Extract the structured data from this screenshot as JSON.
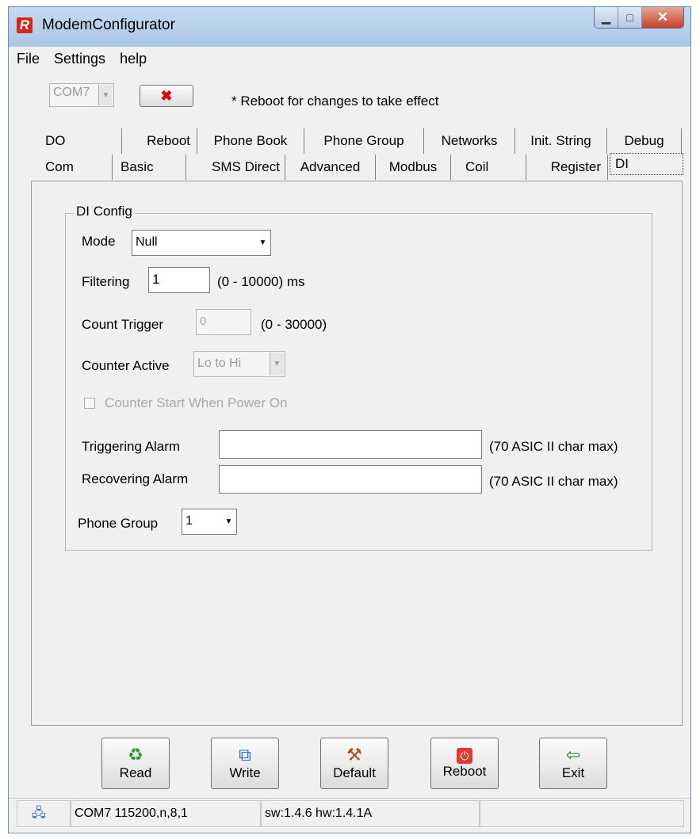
{
  "window": {
    "title": "ModemConfigurator",
    "icon": "R"
  },
  "menu": [
    "File",
    "Settings",
    "help"
  ],
  "toolbar": {
    "com_port": "COM7",
    "disconnect_icon": "red-x-icon",
    "notice": "* Reboot for changes to take effect"
  },
  "tabs": {
    "row1": [
      "DO",
      "Reboot",
      "Phone Book",
      "Phone Group",
      "Networks",
      "Init. String",
      "Debug"
    ],
    "row2": [
      "Com",
      "Basic",
      "SMS Direct",
      "Advanced",
      "Modbus",
      "Coil",
      "Register",
      "DI"
    ],
    "active": "DI"
  },
  "di_config": {
    "group_title": "DI Config",
    "mode_label": "Mode",
    "mode_value": "Null",
    "filtering_label": "Filtering",
    "filtering_value": "1",
    "filtering_range": "(0 - 10000) ms",
    "count_trigger_label": "Count Trigger",
    "count_trigger_value": "0",
    "count_trigger_range": "(0 - 30000)",
    "counter_active_label": "Counter Active",
    "counter_active_value": "Lo to Hi",
    "counter_start_label": "Counter Start When Power On",
    "triggering_alarm_label": "Triggering Alarm",
    "triggering_alarm_value": "",
    "triggering_alarm_hint": "(70 ASIC II char max)",
    "recovering_alarm_label": "Recovering Alarm",
    "recovering_alarm_value": "",
    "recovering_alarm_hint": "(70 ASIC II char max)",
    "phone_group_label": "Phone Group",
    "phone_group_value": "1"
  },
  "buttons": [
    {
      "label": "Read",
      "icon": "recycle-icon"
    },
    {
      "label": "Write",
      "icon": "write-icon"
    },
    {
      "label": "Default",
      "icon": "hammer-icon"
    },
    {
      "label": "Reboot",
      "icon": "power-icon"
    },
    {
      "label": "Exit",
      "icon": "exit-door-icon"
    }
  ],
  "status": {
    "connection": "COM7 115200,n,8,1",
    "version": "sw:1.4.6 hw:1.4.1A"
  }
}
